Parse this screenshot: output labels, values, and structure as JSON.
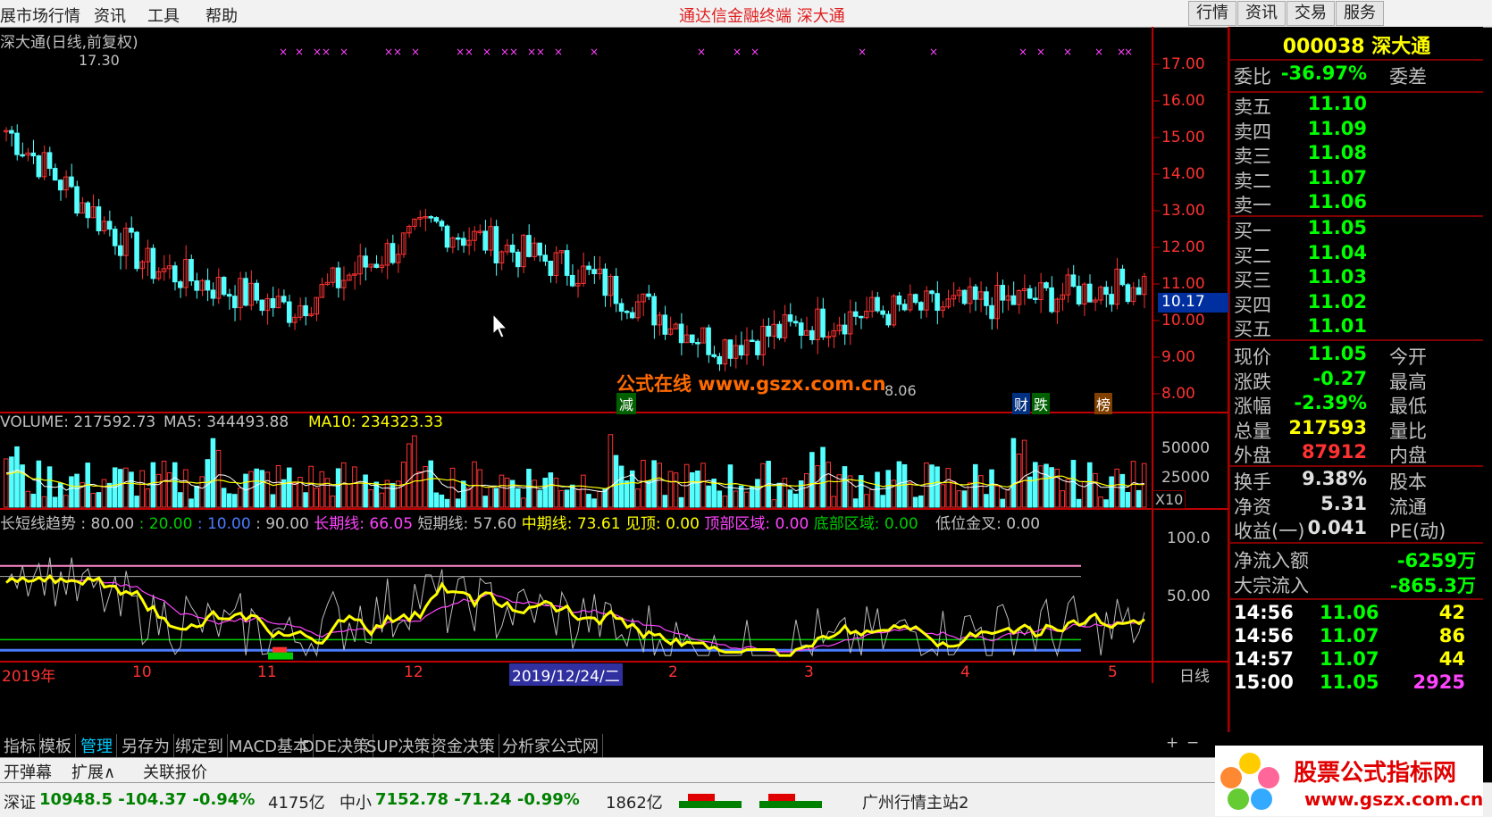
{
  "menu": {
    "items": [
      "展市场行情",
      "资讯",
      "工具",
      "帮助"
    ],
    "brand": "通达信金融终端   深大通",
    "right_buttons": [
      "行情",
      "资讯",
      "交易",
      "服务"
    ]
  },
  "chart": {
    "title": "深大通(日线,前复权)",
    "high_mark": "17.30",
    "low_mark": "8.06",
    "price_ticks": [
      "17.00",
      "16.00",
      "15.00",
      "14.00",
      "13.00",
      "12.00",
      "11.00",
      "10.00",
      "9.00",
      "8.00"
    ],
    "current_price_tag": "10.17",
    "events": {
      "jian": "减",
      "cai": "财",
      "die": "跌",
      "bang": "榜"
    },
    "watermark": "公式在线 www.gszx.com.cn",
    "volume_header": {
      "volume": "VOLUME: 217592.73",
      "ma5": "MA5: 344493.88",
      "ma10": "MA10: 234323.33"
    },
    "volume_ticks": [
      "50000",
      "25000"
    ],
    "volume_unit": "X10",
    "indicator_header": {
      "name": "长短线趋势",
      "p1": ": 80.00",
      "p2": ": 20.00",
      "p3": ": 10.00",
      "p4": ": 90.00",
      "long": "长期线: 66.05",
      "short": "短期线: 57.60",
      "mid": "中期线: 73.61",
      "top": "见顶: 0.00",
      "top_zone": "顶部区域: 0.00",
      "bottom_zone": "底部区域: 0.00",
      "low_cross": "低位金叉: 0.00"
    },
    "indicator_ticks": [
      "100.0",
      "50.00"
    ],
    "date_axis": [
      "2019年",
      "10",
      "11",
      "12",
      "2",
      "3",
      "4",
      "5"
    ],
    "date_cursor": "2019/12/24/二",
    "period": "日线",
    "colors": {
      "up": "#ff3232",
      "down": "#54ffff",
      "axis": "#c00000",
      "yellow": "#ffff00",
      "magenta": "#ff44ff",
      "green": "#00cc00",
      "blue": "#4a7cff"
    }
  },
  "chart_data": {
    "type": "candlestick",
    "title": "深大通(日线,前复权)",
    "ylim": [
      7.6,
      17.5
    ],
    "x": [
      "2019-09",
      "2019-10",
      "2019-11",
      "2019-12",
      "2020-01",
      "2020-02",
      "2020-03",
      "2020-04",
      "2020-05"
    ],
    "close": [
      15.2,
      11.5,
      10.3,
      12.6,
      11.4,
      9.3,
      10.2,
      10.5,
      11.05
    ],
    "volume_unit": "X10",
    "volume_last": 217592.73,
    "ma5_last": 344493.88,
    "ma10_last": 234323.33
  },
  "quote": {
    "code_name": "000038 深大通",
    "weibi": {
      "k": "委比",
      "v": "-36.97%",
      "k2": "委差"
    },
    "sells": [
      {
        "k": "卖五",
        "v": "11.10"
      },
      {
        "k": "卖四",
        "v": "11.09"
      },
      {
        "k": "卖三",
        "v": "11.08"
      },
      {
        "k": "卖二",
        "v": "11.07"
      },
      {
        "k": "卖一",
        "v": "11.06"
      }
    ],
    "buys": [
      {
        "k": "买一",
        "v": "11.05"
      },
      {
        "k": "买二",
        "v": "11.04"
      },
      {
        "k": "买三",
        "v": "11.03"
      },
      {
        "k": "买四",
        "v": "11.02"
      },
      {
        "k": "买五",
        "v": "11.01"
      }
    ],
    "stats": [
      {
        "k": "现价",
        "v": "11.05",
        "k2": "今开",
        "c": "#00ff00"
      },
      {
        "k": "涨跌",
        "v": "-0.27",
        "k2": "最高",
        "c": "#00ff00"
      },
      {
        "k": "涨幅",
        "v": "-2.39%",
        "k2": "最低",
        "c": "#00ff00"
      },
      {
        "k": "总量",
        "v": "217593",
        "k2": "量比",
        "c": "#ffff00"
      },
      {
        "k": "外盘",
        "v": "87912",
        "k2": "内盘",
        "c": "#ff3232"
      }
    ],
    "extra": [
      {
        "k": "换手",
        "v": "9.38%",
        "k2": "股本",
        "c": "#c0c0c0"
      },
      {
        "k": "净资",
        "v": "5.31",
        "k2": "流通",
        "c": "#c0c0c0"
      },
      {
        "k": "收益(一)",
        "v": "0.041",
        "k2": "PE(动)",
        "c": "#c0c0c0"
      }
    ],
    "flows": [
      {
        "k": "净流入额",
        "v": "-6259万"
      },
      {
        "k": "大宗流入",
        "v": "-865.3万"
      }
    ],
    "ticks": [
      {
        "t": "14:56",
        "p": "11.06",
        "q": "42",
        "qc": "#ffff00"
      },
      {
        "t": "14:56",
        "p": "11.07",
        "q": "86",
        "qc": "#ffff00"
      },
      {
        "t": "14:57",
        "p": "11.07",
        "q": "44",
        "qc": "#ffff00"
      },
      {
        "t": "15:00",
        "p": "11.05",
        "q": "2925",
        "qc": "#ff44ff"
      }
    ]
  },
  "tabs": [
    "指标",
    "模板",
    "管理",
    "另存为",
    "绑定到",
    "MACD基本",
    "DDE决策",
    "SUP决策",
    "资金决策",
    "分析家公式网"
  ],
  "subtabs": [
    "开弹幕",
    "扩展∧",
    "关联报价"
  ],
  "status": {
    "sz": "深证",
    "sz_val": "10948.5 -104.37 -0.94%",
    "sz_amt": "4175亿",
    "zx": "中小",
    "zx_val": "7152.78 -71.24 -0.99%",
    "zx_amt": "1862亿",
    "server": "广州行情主站2"
  },
  "logo": {
    "title": "股票公式指标网",
    "url": "www.gszx.com.cn"
  }
}
